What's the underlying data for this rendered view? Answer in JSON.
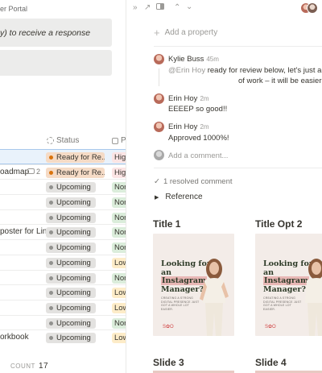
{
  "background": {
    "breadcrumb": "er Portal",
    "callout_text": "y) to receive a response",
    "columns": {
      "status": "Status",
      "priority": "P"
    },
    "rows": [
      {
        "name": "",
        "status": "Ready for Re...",
        "status_kind": "ready",
        "priority": "Hig",
        "priority_color": "#fbe4e4",
        "selected": true
      },
      {
        "name": "oadmap",
        "comments": "2",
        "status": "Ready for Re...",
        "status_kind": "ready",
        "priority": "Hig",
        "priority_color": "#fbe4e4"
      },
      {
        "name": "",
        "status": "Upcoming",
        "status_kind": "upcoming",
        "priority": "Nor",
        "priority_color": "#dbeddb"
      },
      {
        "name": "",
        "status": "Upcoming",
        "status_kind": "upcoming",
        "priority": "Nor",
        "priority_color": "#dbeddb"
      },
      {
        "name": "",
        "status": "Upcoming",
        "status_kind": "upcoming",
        "priority": "Nor",
        "priority_color": "#dbeddb"
      },
      {
        "name": "poster for Lin",
        "status": "Upcoming",
        "status_kind": "upcoming",
        "priority": "Nor",
        "priority_color": "#dbeddb"
      },
      {
        "name": "",
        "status": "Upcoming",
        "status_kind": "upcoming",
        "priority": "Nor",
        "priority_color": "#dbeddb"
      },
      {
        "name": "",
        "status": "Upcoming",
        "status_kind": "upcoming",
        "priority": "Low",
        "priority_color": "#fdecc8"
      },
      {
        "name": "",
        "status": "Upcoming",
        "status_kind": "upcoming",
        "priority": "Nor",
        "priority_color": "#dbeddb"
      },
      {
        "name": "",
        "status": "Upcoming",
        "status_kind": "upcoming",
        "priority": "Low",
        "priority_color": "#fdecc8"
      },
      {
        "name": "",
        "status": "Upcoming",
        "status_kind": "upcoming",
        "priority": "Low",
        "priority_color": "#fdecc8"
      },
      {
        "name": "",
        "status": "Upcoming",
        "status_kind": "upcoming",
        "priority": "Nor",
        "priority_color": "#dbeddb"
      },
      {
        "name": "orkbook",
        "status": "Upcoming",
        "status_kind": "upcoming",
        "priority": "Low",
        "priority_color": "#fdecc8"
      }
    ],
    "count_label": "COUNT",
    "count_value": "17"
  },
  "panel": {
    "add_property": "Add a property",
    "comments": [
      {
        "author": "Kylie Buss",
        "time": "45m",
        "line1_mention": "@Erin Hoy",
        "line1_text": " ready for review below, let's just add comm",
        "line2": "of work – it will be easier to o"
      },
      {
        "author": "Erin Hoy",
        "time": "2m",
        "text": "EEEEP so good!!"
      },
      {
        "author": "Erin Hoy",
        "time": "2m",
        "text": "Approved 1000%!"
      }
    ],
    "add_comment_placeholder": "Add a comment...",
    "resolved_comments": "1 resolved comment",
    "toggle_label": "Reference",
    "gallery": [
      {
        "title": "Title 1",
        "headline": [
          "Looking for an",
          "Instagram",
          "Manager?"
        ],
        "subtext": "CREATING A STRONG DIGITAL PRESENCE JUST GOT A WHOLE LOT EASIER."
      },
      {
        "title": "Title Opt 2",
        "headline": [
          "Looking for an",
          "Instagram",
          "Manager?"
        ],
        "subtext": "CREATING A STRONG DIGITAL PRESENCE JUST GOT A WHOLE LOT EASIER."
      }
    ],
    "slides": [
      {
        "title": "Slide 3"
      },
      {
        "title": "Slide 4"
      }
    ],
    "colors": {
      "accent_blue": "#2383e2",
      "ready_pill": "#f5dbc6",
      "upcoming_pill": "#e3e2e0",
      "card_bg": "#f3ece8",
      "headline_green": "#2e3b28",
      "headline_band": "#e8b7b5"
    }
  }
}
